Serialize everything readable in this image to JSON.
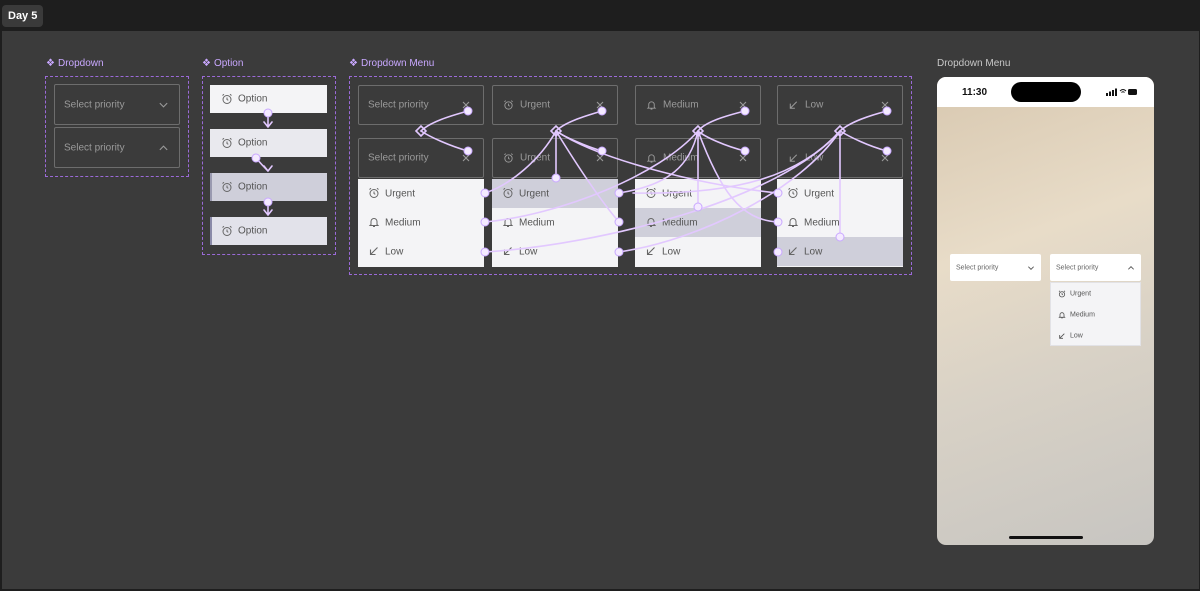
{
  "tab": {
    "label": "Day 5"
  },
  "sections": {
    "dropdown": "Dropdown",
    "option": "Option",
    "dropdown_menu": "Dropdown Menu",
    "phone_frame": "Dropdown Menu"
  },
  "dropdown": {
    "placeholder": "Select priority",
    "states": [
      "collapsed",
      "expanded"
    ]
  },
  "option": {
    "label": "Option",
    "variants": [
      "default",
      "hover",
      "pressed",
      "selected"
    ]
  },
  "dropdown_menu": {
    "columns": [
      {
        "header": "Select priority",
        "header_icon": "none",
        "header_icon_close": "close-icon"
      },
      {
        "header": "Urgent",
        "header_icon": "alarm-clock-icon"
      },
      {
        "header": "Medium",
        "header_icon": "bell-icon"
      },
      {
        "header": "Low",
        "header_icon": "arrow-down-left-icon"
      }
    ],
    "items": [
      {
        "label": "Urgent",
        "icon": "alarm-clock-icon"
      },
      {
        "label": "Medium",
        "icon": "bell-icon"
      },
      {
        "label": "Low",
        "icon": "arrow-down-left-icon"
      }
    ],
    "selected_index_per_column": [
      null,
      0,
      1,
      2
    ]
  },
  "phone": {
    "time": "11:30",
    "left_dropdown": "Select priority",
    "right_dropdown": "Select priority",
    "menu_items": [
      {
        "label": "Urgent",
        "icon": "alarm-clock-icon"
      },
      {
        "label": "Medium",
        "icon": "bell-icon"
      },
      {
        "label": "Low",
        "icon": "arrow-down-left-icon"
      }
    ]
  },
  "colors": {
    "canvas": "#3b3b3b",
    "accent": "#c9a8ff",
    "wire": "#e2c8ff",
    "menu_bg": "#f4f4f6",
    "selected_row": "#cfcfda"
  }
}
